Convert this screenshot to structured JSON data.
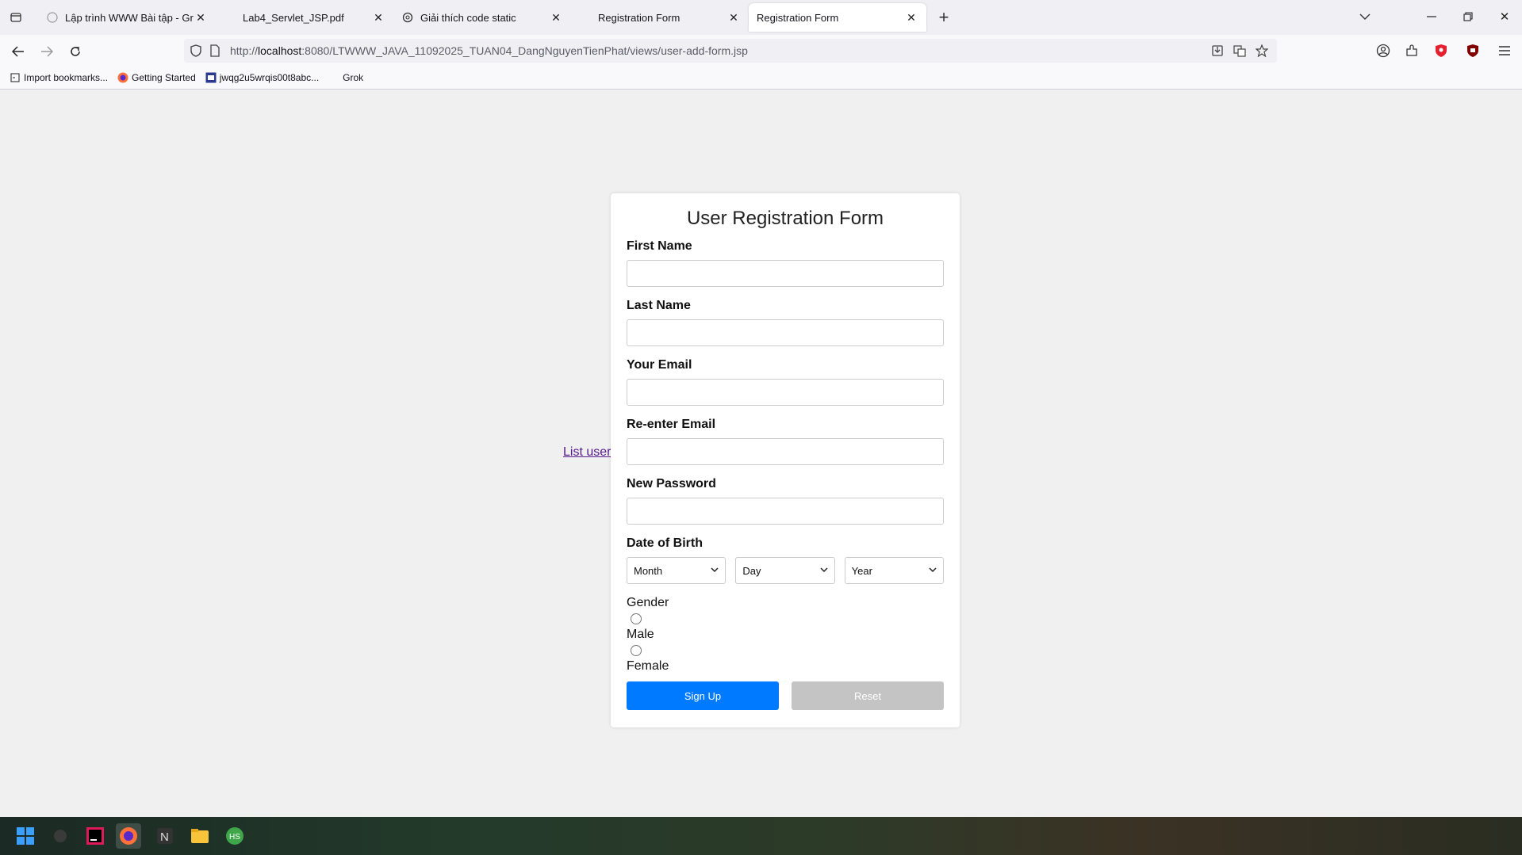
{
  "browser": {
    "tabs": [
      {
        "title": "Lập trình WWW Bài tập - Grok",
        "icon": "grok-icon"
      },
      {
        "title": "Lab4_Servlet_JSP.pdf",
        "icon": "pdf-icon"
      },
      {
        "title": "Giải thích code static",
        "icon": "chatgpt-icon"
      },
      {
        "title": "Registration Form",
        "icon": "page-icon"
      },
      {
        "title": "Registration Form",
        "icon": "page-icon",
        "active": true
      }
    ],
    "url_prefix": "http://",
    "url_host": "localhost",
    "url_rest": ":8080/LTWWW_JAVA_11092025_TUAN04_DangNguyenTienPhat/views/user-add-form.jsp",
    "bookmarks": [
      {
        "label": "Import bookmarks...",
        "icon": "import-icon"
      },
      {
        "label": "Getting Started",
        "icon": "firefox-icon"
      },
      {
        "label": "jwqg2u5wrqis00t8abc...",
        "icon": "site-icon"
      },
      {
        "label": "Grok",
        "icon": "grok-icon"
      }
    ]
  },
  "page": {
    "list_link": "List user",
    "form": {
      "title": "User Registration Form",
      "first_name_label": "First Name",
      "last_name_label": "Last Name",
      "email_label": "Your Email",
      "reenter_email_label": "Re-enter Email",
      "password_label": "New Password",
      "dob_label": "Date of Birth",
      "month": "Month",
      "day": "Day",
      "year": "Year",
      "gender_label": "Gender",
      "male": "Male",
      "female": "Female",
      "signup": "Sign Up",
      "reset": "Reset"
    }
  },
  "colors": {
    "primary_button": "#007bff",
    "reset_button": "#c4c4c4",
    "link_visited": "#551a8b"
  }
}
